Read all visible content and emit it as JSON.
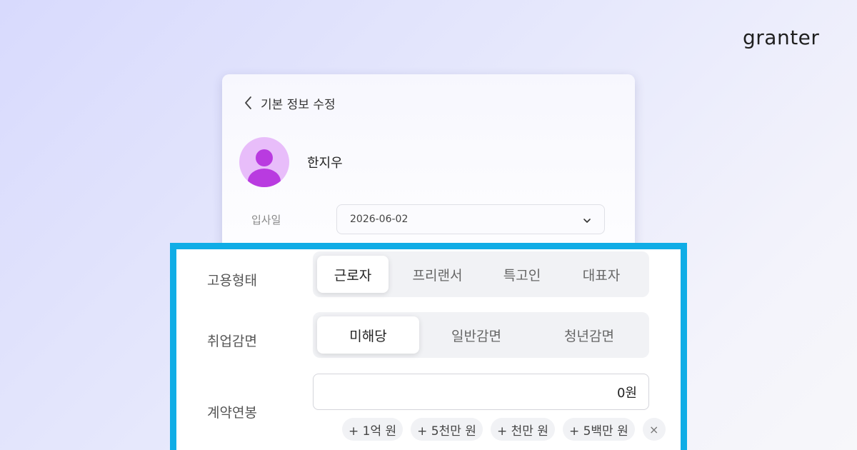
{
  "brand": {
    "logo_text": "granter"
  },
  "profile_card": {
    "title": "기본 정보 수정",
    "user_name": "한지우",
    "hire_date": {
      "label": "입사일",
      "value": "2026-06-02"
    }
  },
  "form": {
    "employment_type": {
      "label": "고용형태",
      "options": [
        "근로자",
        "프리랜서",
        "특고인",
        "대표자"
      ],
      "selected": "근로자"
    },
    "employment_reduction": {
      "label": "취업감면",
      "options": [
        "미해당",
        "일반감면",
        "청년감면"
      ],
      "selected": "미해당"
    },
    "annual_salary": {
      "label": "계약연봉",
      "value": "0원",
      "quick_add": [
        "+ 1억 원",
        "+ 5천만 원",
        "+ 천만 원",
        "+ 5백만 원"
      ],
      "clear_symbol": "×"
    }
  },
  "colors": {
    "highlight_border": "#10ade6",
    "avatar_bg": "#e8bdfa",
    "avatar_figure": "#b93be0"
  }
}
